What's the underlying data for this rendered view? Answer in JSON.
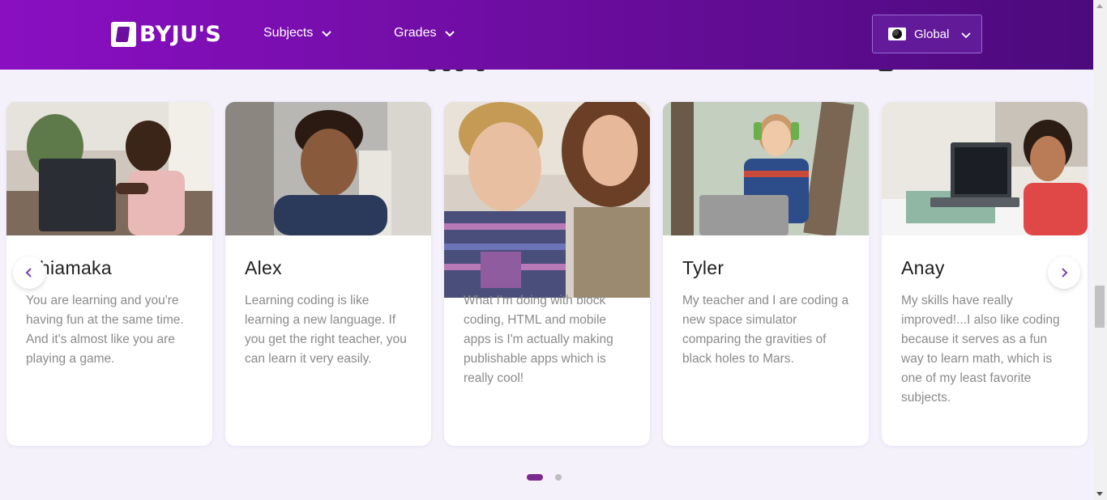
{
  "header": {
    "logo_text": "BYJU'S",
    "nav": [
      {
        "label": "Subjects"
      },
      {
        "label": "Grades"
      }
    ],
    "region": {
      "label": "Global"
    }
  },
  "testimonials": [
    {
      "name": "Chiamaka",
      "quote": "You are learning and you're having fun at the same time. And it's almost like you are playing a game."
    },
    {
      "name": "Alex",
      "quote": "Learning coding is like learning a new language. If you get the right teacher, you can learn it very easily."
    },
    {
      "name": "",
      "quote": "What I'm doing with block coding, HTML and mobile apps is I'm actually making publishable apps which is really cool!"
    },
    {
      "name": "Tyler",
      "quote": "My teacher and I are coding a new space simulator comparing the gravities of black holes to Mars."
    },
    {
      "name": "Anay",
      "quote": "My skills have really improved!...I also like coding because it serves as a fun way to learn math, which is one of my least favorite subjects."
    }
  ],
  "carousel": {
    "pages": 2,
    "active_page": 1
  },
  "colors": {
    "header_start": "#8a0fc2",
    "header_end": "#4c0a7c",
    "page_bg": "#f4f1fb",
    "accent": "#7a2a8e"
  }
}
